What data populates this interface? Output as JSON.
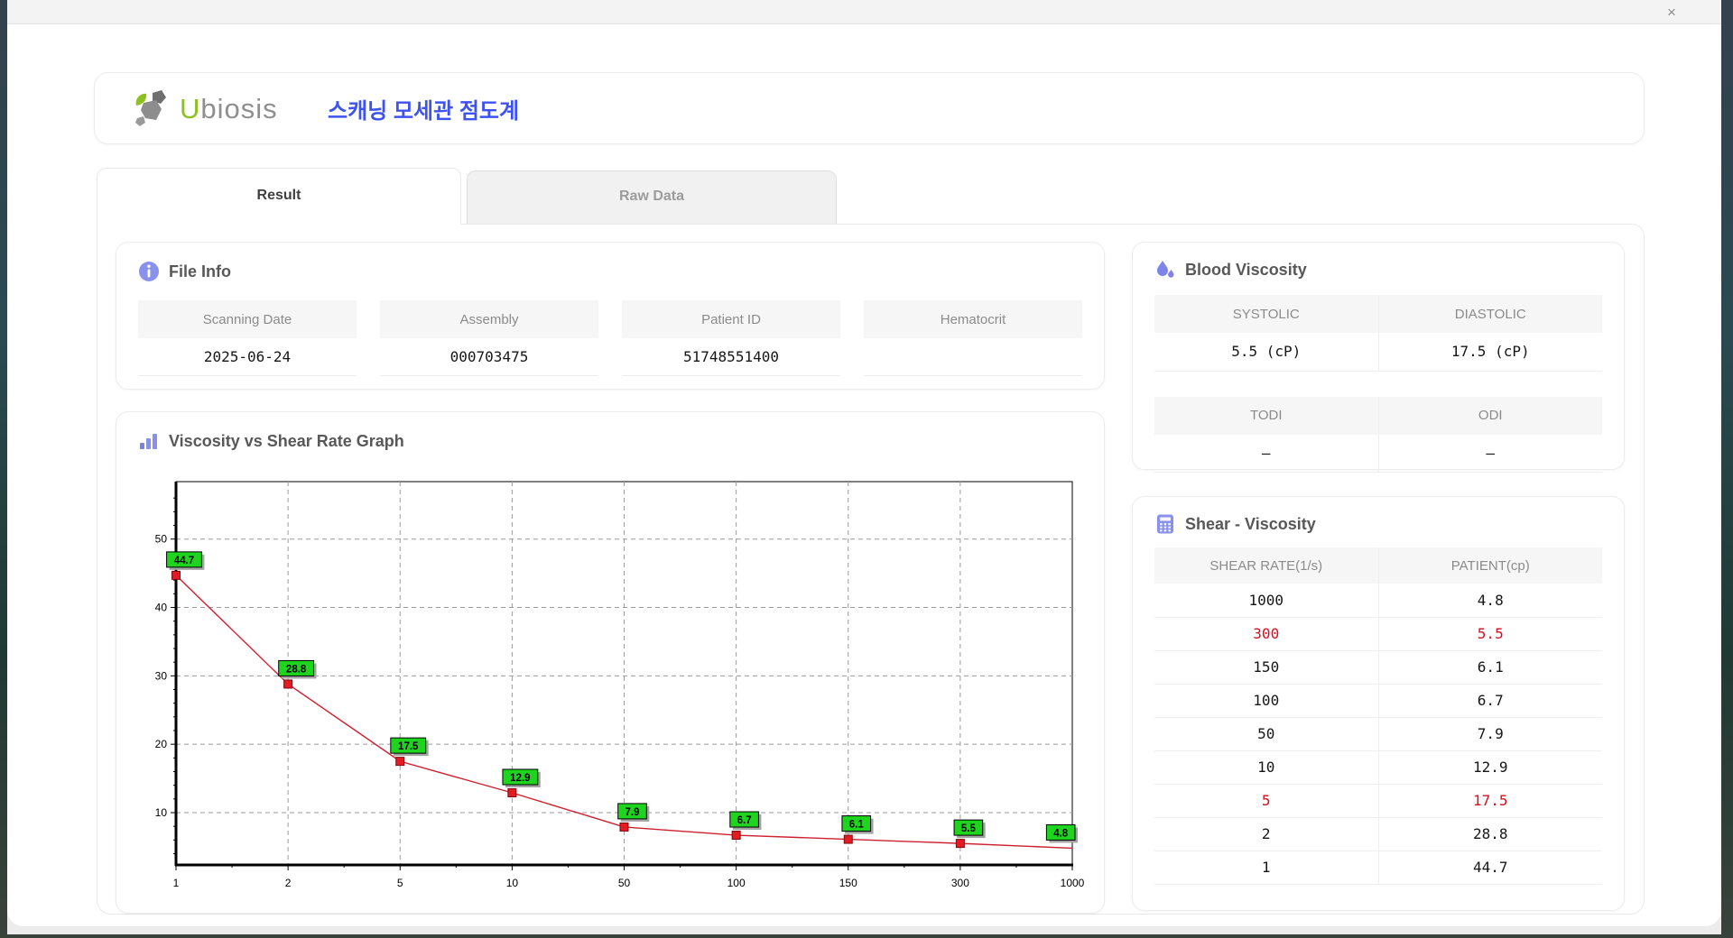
{
  "window": {
    "close_icon": "×"
  },
  "brand": {
    "logo_u": "U",
    "logo_rest": "biosis",
    "app_title": "스캐닝 모세관 점도계"
  },
  "tabs": {
    "result": "Result",
    "raw_data": "Raw Data"
  },
  "file_info": {
    "title": "File Info",
    "fields": [
      {
        "label": "Scanning Date",
        "value": "2025-06-24"
      },
      {
        "label": "Assembly",
        "value": "000703475"
      },
      {
        "label": "Patient ID",
        "value": "51748551400"
      },
      {
        "label": "Hematocrit",
        "value": ""
      }
    ]
  },
  "blood_viscosity": {
    "title": "Blood Viscosity",
    "pairs": [
      {
        "labels": [
          "SYSTOLIC",
          "DIASTOLIC"
        ],
        "values": [
          "5.5 (cP)",
          "17.5 (cP)"
        ]
      },
      {
        "labels": [
          "TODI",
          "ODI"
        ],
        "values": [
          "–",
          "–"
        ]
      }
    ]
  },
  "shear_viscosity": {
    "title": "Shear - Viscosity",
    "columns": [
      "SHEAR RATE(1/s)",
      "PATIENT(cp)"
    ],
    "rows": [
      {
        "shear": "1000",
        "patient": "4.8",
        "highlight": false
      },
      {
        "shear": "300",
        "patient": "5.5",
        "highlight": true
      },
      {
        "shear": "150",
        "patient": "6.1",
        "highlight": false
      },
      {
        "shear": "100",
        "patient": "6.7",
        "highlight": false
      },
      {
        "shear": "50",
        "patient": "7.9",
        "highlight": false
      },
      {
        "shear": "10",
        "patient": "12.9",
        "highlight": false
      },
      {
        "shear": "5",
        "patient": "17.5",
        "highlight": true
      },
      {
        "shear": "2",
        "patient": "28.8",
        "highlight": false
      },
      {
        "shear": "1",
        "patient": "44.7",
        "highlight": false
      }
    ],
    "highlight_color": "#d2101e"
  },
  "graph": {
    "title": "Viscosity vs Shear Rate Graph"
  },
  "chart_data": {
    "type": "line",
    "title": "Viscosity vs Shear Rate Graph",
    "x": [
      1,
      2,
      5,
      10,
      50,
      100,
      150,
      300,
      1000
    ],
    "x_labels": [
      "1",
      "2",
      "5",
      "10",
      "50",
      "100",
      "150",
      "300",
      "1000"
    ],
    "values": [
      44.7,
      28.8,
      17.5,
      12.9,
      7.9,
      6.7,
      6.1,
      5.5,
      4.8
    ],
    "point_labels": [
      "44.7",
      "28.8",
      "17.5",
      "12.9",
      "7.9",
      "6.7",
      "6.1",
      "5.5",
      "4.8"
    ],
    "xlabel": "",
    "ylabel": "",
    "y_ticks": [
      10,
      20,
      30,
      40,
      50
    ],
    "y_range": [
      2.35,
      58.4
    ],
    "x_axis_type": "categorical-even-spacing",
    "grid": "dashed-gray",
    "legend": "none",
    "line_color": "#cf2030",
    "marker_color": "#e31b23",
    "marker_border": "#7d0a0e",
    "label_bg": "#1fd41f",
    "label_border": "#000000"
  }
}
